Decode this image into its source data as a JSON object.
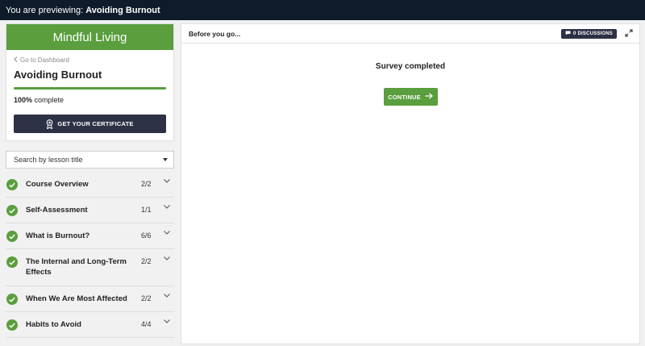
{
  "preview_bar": {
    "prefix": "You are previewing:",
    "course_title": "Avoiding Burnout"
  },
  "sidebar": {
    "brand": "Mindful Living",
    "back_link": "Go to Dashboard",
    "course_title": "Avoiding Burnout",
    "progress_fraction": 1.0,
    "progress_percent": "100%",
    "progress_suffix": "complete",
    "certificate_button": "GET YOUR CERTIFICATE",
    "search_placeholder": "Search by lesson title",
    "lessons": [
      {
        "title": "Course Overview",
        "count": "2/2"
      },
      {
        "title": "Self-Assessment",
        "count": "1/1"
      },
      {
        "title": "What is Burnout?",
        "count": "6/6"
      },
      {
        "title": "The Internal and Long-Term Effects",
        "count": "2/2"
      },
      {
        "title": "When We Are Most Affected",
        "count": "2/2"
      },
      {
        "title": "Habits to Avoid",
        "count": "4/4"
      }
    ]
  },
  "main": {
    "header_title": "Before you go...",
    "discussions_label": "0 DISCUSSIONS",
    "status_text": "Survey completed",
    "continue_label": "CONTINUE"
  },
  "colors": {
    "brand_green": "#5a9e3e",
    "dark_button": "#2c3145",
    "top_bar": "#0f1b2a"
  },
  "icons": [
    "chevron-left-icon",
    "award-icon",
    "caret-down-icon",
    "check-circle-icon",
    "chevron-down-icon",
    "chat-icon",
    "expand-icon",
    "arrow-right-icon"
  ]
}
